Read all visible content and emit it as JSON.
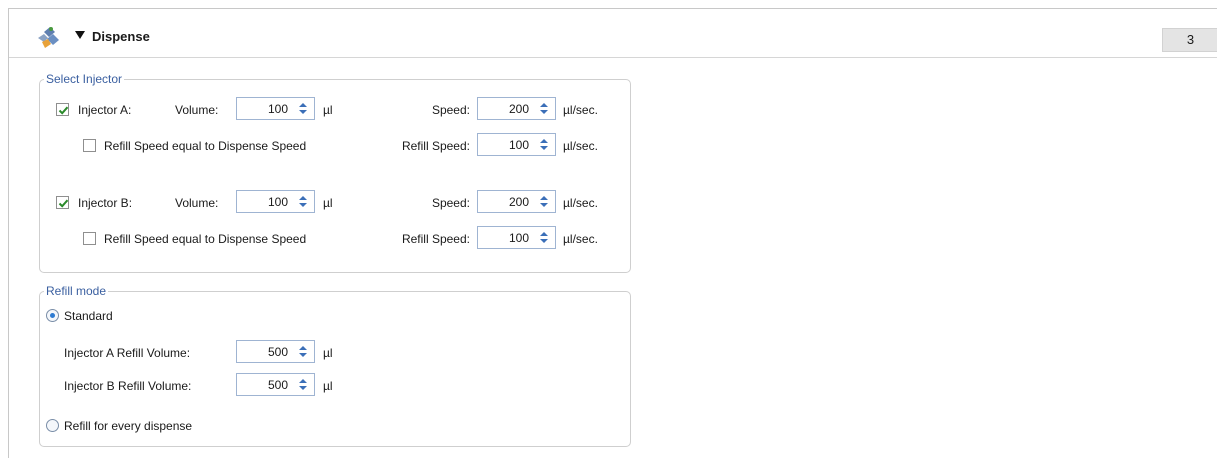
{
  "header": {
    "title": "Dispense",
    "step_number": "3",
    "icon": "injector-app-icon",
    "collapse_icon": "triangle-down-icon"
  },
  "select_injector": {
    "legend": "Select Injector",
    "injectors": [
      {
        "checkbox_label": "Injector A:",
        "checked": true,
        "volume_label": "Volume:",
        "volume": "100",
        "volume_unit": "µl",
        "speed_label": "Speed:",
        "speed": "200",
        "speed_unit": "µl/sec.",
        "refill_equal_label": "Refill Speed equal to Dispense Speed",
        "refill_equal_checked": false,
        "refill_speed_label": "Refill Speed:",
        "refill_speed": "100",
        "refill_speed_unit": "µl/sec."
      },
      {
        "checkbox_label": "Injector B:",
        "checked": true,
        "volume_label": "Volume:",
        "volume": "100",
        "volume_unit": "µl",
        "speed_label": "Speed:",
        "speed": "200",
        "speed_unit": "µl/sec.",
        "refill_equal_label": "Refill Speed equal to Dispense Speed",
        "refill_equal_checked": false,
        "refill_speed_label": "Refill Speed:",
        "refill_speed": "100",
        "refill_speed_unit": "µl/sec."
      }
    ]
  },
  "refill_mode": {
    "legend": "Refill mode",
    "standard_label": "Standard",
    "standard_selected": true,
    "a_refill_label": "Injector A Refill Volume:",
    "a_refill_value": "500",
    "a_refill_unit": "µl",
    "b_refill_label": "Injector B Refill Volume:",
    "b_refill_value": "500",
    "b_refill_unit": "µl",
    "every_dispense_label": "Refill for every dispense",
    "every_dispense_selected": false
  }
}
